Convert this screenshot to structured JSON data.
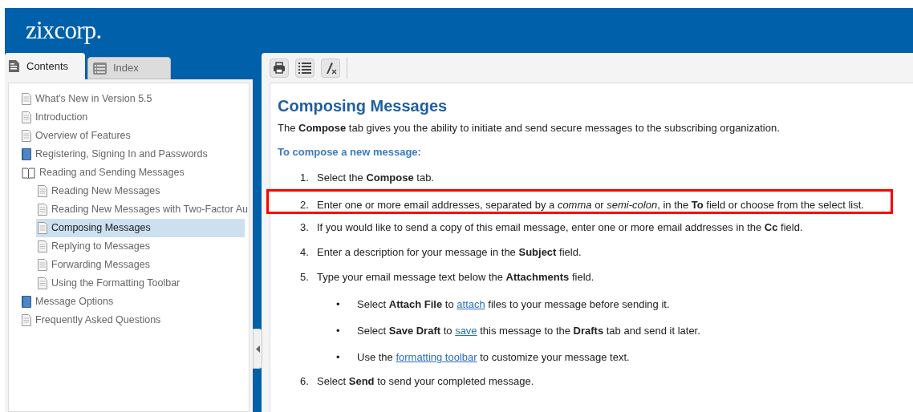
{
  "header": {
    "logo": "zixcorp."
  },
  "tabs": [
    {
      "label": "Contents",
      "selected": true,
      "kind": "contents"
    },
    {
      "label": "Index",
      "selected": false,
      "kind": "index"
    }
  ],
  "toc": [
    {
      "label": "What's New in Version 5.5",
      "kind": "page",
      "selected": false
    },
    {
      "label": "Introduction",
      "kind": "page",
      "selected": false
    },
    {
      "label": "Overview of Features",
      "kind": "page",
      "selected": false
    },
    {
      "label": "Registering, Signing In and Passwords",
      "kind": "book",
      "selected": false
    },
    {
      "label": "Reading and Sending Messages",
      "kind": "open-book",
      "selected": false,
      "children": [
        {
          "label": "Reading New Messages",
          "kind": "page",
          "selected": false
        },
        {
          "label": "Reading New Messages with Two-Factor Au",
          "kind": "page",
          "selected": false
        },
        {
          "label": "Composing Messages",
          "kind": "page",
          "selected": true
        },
        {
          "label": "Replying to Messages",
          "kind": "page",
          "selected": false
        },
        {
          "label": "Forwarding Messages",
          "kind": "page",
          "selected": false
        },
        {
          "label": "Using the Formatting Toolbar",
          "kind": "page",
          "selected": false
        }
      ]
    },
    {
      "label": "Message Options",
      "kind": "book",
      "selected": false
    },
    {
      "label": "Frequently Asked Questions",
      "kind": "page",
      "selected": false
    }
  ],
  "toolbar": [
    {
      "kind": "print"
    },
    {
      "kind": "list"
    },
    {
      "kind": "clear-format"
    }
  ],
  "article": {
    "title": "Composing Messages",
    "intro": "The **Compose** tab gives you the ability to initiate and send secure messages to the subscribing organization.",
    "subheading": "To compose a new message:",
    "steps": [
      {
        "number": "1.",
        "text": "Select the **Compose** tab.",
        "highlighted": false
      },
      {
        "number": "2.",
        "text": "Enter one or more email addresses, separated by a *comma* or *semi-colon*, in the **To** field or choose from the select list.",
        "highlighted": true
      },
      {
        "number": "3.",
        "text": "If you would like to send a copy of this email message, enter one or more email addresses in the **Cc** field.",
        "highlighted": false
      },
      {
        "number": "4.",
        "text": "Enter a description for your message in the **Subject** field.",
        "highlighted": false
      },
      {
        "number": "5.",
        "text": "Type your email message text below the **Attachments** field.",
        "highlighted": false,
        "bullets": [
          {
            "bullet": "•",
            "before": "Select **Attach File** to",
            "link": "attach",
            "after": "files to your message before sending it."
          },
          {
            "bullet": "•",
            "before": "Select **Save Draft** to",
            "link": "save",
            "after": "this message to the **Drafts** tab and send it later."
          },
          {
            "bullet": "•",
            "before": "Use the",
            "link": "formatting toolbar",
            "after": "to customize your message text."
          }
        ]
      },
      {
        "number": "6.",
        "text": "Select **Send** to send your completed message.",
        "highlighted": false
      }
    ]
  }
}
